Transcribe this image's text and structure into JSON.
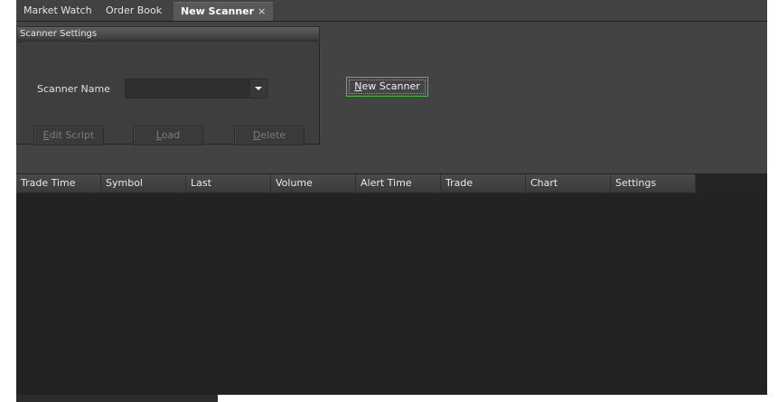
{
  "tabs": [
    {
      "label": "Market Watch",
      "active": false
    },
    {
      "label": "Order Book",
      "active": false
    },
    {
      "label": "New Scanner",
      "active": true,
      "close_glyph": "×"
    }
  ],
  "scanner_settings": {
    "title": "Scanner Settings",
    "name_label": "Scanner Name",
    "name_value": "",
    "buttons": {
      "edit_script": {
        "mnemonic": "E",
        "rest": "dit Script"
      },
      "load": {
        "mnemonic": "L",
        "rest": "oad"
      },
      "delete": {
        "mnemonic": "D",
        "rest": "elete"
      }
    }
  },
  "new_scanner_button": {
    "mnemonic": "N",
    "rest": "ew Scanner"
  },
  "grid": {
    "columns": [
      "Trade Time",
      "Symbol",
      "Last",
      "Volume",
      "Alert Time",
      "Trade",
      "Chart",
      "Settings"
    ],
    "rows": []
  },
  "colors": {
    "focus_border": "#3fc13f",
    "background": "#242424"
  }
}
